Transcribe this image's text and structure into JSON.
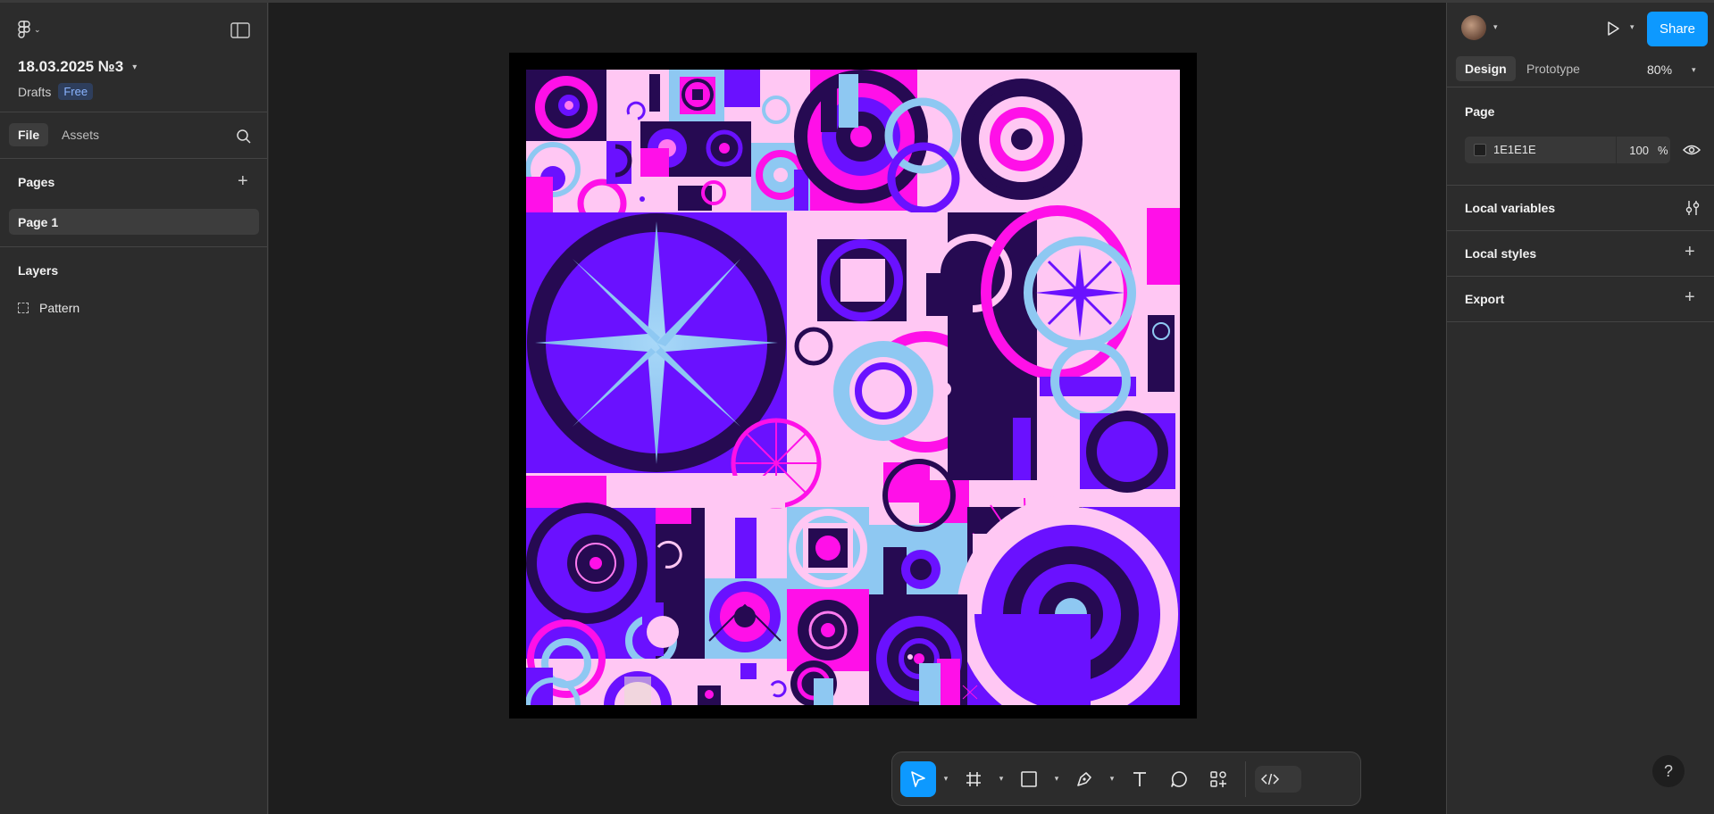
{
  "file": {
    "title": "18.03.2025 №3",
    "location": "Drafts",
    "plan_badge": "Free"
  },
  "left_panel": {
    "tabs": [
      "File",
      "Assets"
    ],
    "pages_title": "Pages",
    "pages": [
      "Page 1"
    ],
    "layers_title": "Layers",
    "layers": [
      "Pattern"
    ]
  },
  "right_panel": {
    "share_label": "Share",
    "tabs": [
      "Design",
      "Prototype"
    ],
    "zoom": "80%",
    "page_section": "Page",
    "page_color": "1E1E1E",
    "page_opacity": "100",
    "page_opacity_unit": "%",
    "local_variables": "Local variables",
    "local_styles": "Local styles",
    "export": "Export",
    "help": "?"
  },
  "toolbar": {
    "tools": [
      "move-tool",
      "frame-tool",
      "rectangle-tool",
      "pen-tool",
      "text-tool",
      "comment-tool",
      "actions-tool",
      "dev-mode-toggle"
    ]
  },
  "colors": {
    "accent": "#0d99ff",
    "canvas": "#1e1e1e",
    "panel": "#2c2c2c",
    "art_pink": "#ffc7f3",
    "art_violet": "#6a11ff",
    "art_dark": "#260a52",
    "art_magenta": "#ff10e8",
    "art_sky": "#8ec8f2"
  }
}
